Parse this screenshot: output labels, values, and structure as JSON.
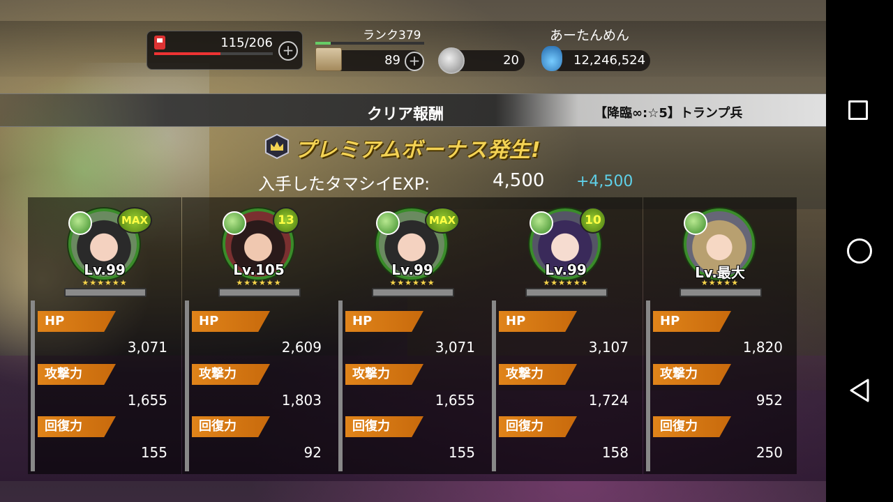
{
  "header": {
    "stamina": "115/206",
    "stamina_fraction": 0.56,
    "rank_label": "ランク379",
    "rank_fraction": 0.14,
    "box_count": "89",
    "coin_count": "20",
    "player_name": "あーたんめん",
    "gem_count": "12,246,524"
  },
  "reward": {
    "title": "クリア報酬",
    "stage": "【降臨∞:☆5】トランプ兵",
    "bonus_text": "プレミアムボーナス発生!",
    "exp_label": "入手したタマシイEXP:",
    "exp_value": "4,500",
    "exp_gain": "+4,500"
  },
  "stat_labels": {
    "hp": "HP",
    "atk": "攻撃力",
    "rec": "回復力"
  },
  "stars_glyph": "★★★★★★",
  "cards": [
    {
      "badge": "MAX",
      "level": "Lv.99",
      "hp": "3,071",
      "atk": "1,655",
      "rec": "155",
      "stars": "★★★★★★"
    },
    {
      "badge": "13",
      "level": "Lv.105",
      "hp": "2,609",
      "atk": "1,803",
      "rec": "92",
      "stars": "★★★★★★"
    },
    {
      "badge": "MAX",
      "level": "Lv.99",
      "hp": "3,071",
      "atk": "1,655",
      "rec": "155",
      "stars": "★★★★★★"
    },
    {
      "badge": "10",
      "level": "Lv.99",
      "hp": "3,107",
      "atk": "1,724",
      "rec": "158",
      "stars": "★★★★★★"
    },
    {
      "badge": "",
      "level": "Lv.最大",
      "hp": "1,820",
      "atk": "952",
      "rec": "250",
      "stars": "★★★★★"
    }
  ],
  "colors": {
    "stat_tag": "#e0841a",
    "bonus_gold": "#f3d254",
    "exp_gain": "#5fd0e8",
    "frame_green": "#3a8c2a"
  }
}
